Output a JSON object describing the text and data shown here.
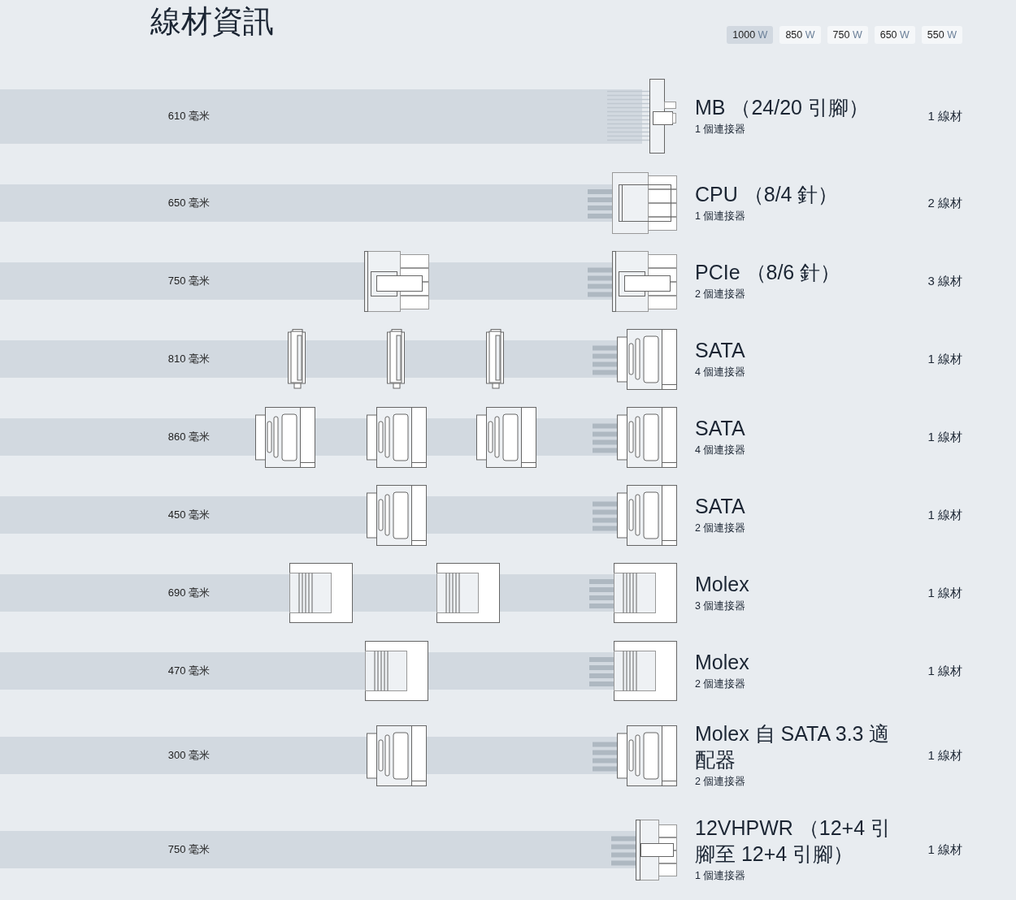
{
  "title": "線材資訊",
  "wattages": [
    {
      "value": "1000",
      "unit": "W",
      "selected": true
    },
    {
      "value": "850",
      "unit": "W",
      "selected": false
    },
    {
      "value": "750",
      "unit": "W",
      "selected": false
    },
    {
      "value": "650",
      "unit": "W",
      "selected": false
    },
    {
      "value": "550",
      "unit": "W",
      "selected": false
    }
  ],
  "cables": [
    {
      "kind": "mb",
      "length": "610 毫米",
      "name": "MB （24/20 引腳）",
      "connectors": "1 個連接器",
      "count": "1 線材"
    },
    {
      "kind": "cpu",
      "length": "650 毫米",
      "name": "CPU （8/4 針）",
      "connectors": "1 個連接器",
      "count": "2 線材"
    },
    {
      "kind": "pcie",
      "length": "750 毫米",
      "name": "PCIe （8/6 針）",
      "connectors": "2 個連接器",
      "count": "3 線材",
      "inline_plugs": [
        {
          "kind": "pcie"
        }
      ]
    },
    {
      "kind": "sata",
      "length": "810 毫米",
      "name": "SATA",
      "connectors": "4 個連接器",
      "count": "1 線材",
      "inline_plugs": [
        {
          "kind": "sata-slim"
        },
        {
          "kind": "sata-slim"
        },
        {
          "kind": "sata-slim"
        }
      ]
    },
    {
      "kind": "sata",
      "length": "860 毫米",
      "name": "SATA",
      "connectors": "4 個連接器",
      "count": "1 線材",
      "inline_plugs": [
        {
          "kind": "sata"
        },
        {
          "kind": "sata"
        },
        {
          "kind": "sata"
        }
      ]
    },
    {
      "kind": "sata",
      "length": "450 毫米",
      "name": "SATA",
      "connectors": "2 個連接器",
      "count": "1 線材",
      "inline_plugs": [
        {
          "kind": "sata"
        }
      ]
    },
    {
      "kind": "molex",
      "length": "690 毫米",
      "name": "Molex",
      "connectors": "3 個連接器",
      "count": "1 線材",
      "inline_plugs": [
        {
          "kind": "molex"
        },
        {
          "kind": "molex"
        }
      ]
    },
    {
      "kind": "molex",
      "length": "470 毫米",
      "name": "Molex",
      "connectors": "2 個連接器",
      "count": "1 線材",
      "inline_plugs": [
        {
          "kind": "molex"
        }
      ]
    },
    {
      "kind": "sata",
      "length": "300 毫米",
      "name": "Molex 自 SATA 3.3 適配器",
      "connectors": "2 個連接器",
      "count": "1 線材",
      "inline_plugs": [
        {
          "kind": "sata"
        }
      ]
    },
    {
      "kind": "hpwr",
      "length": "750 毫米",
      "name": "12VHPWR （12+4 引腳至 12+4 引腳）",
      "connectors": "1 個連接器",
      "count": "1 線材"
    }
  ]
}
